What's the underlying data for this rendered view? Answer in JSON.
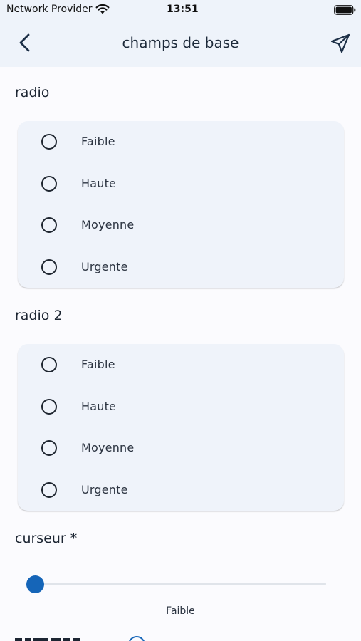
{
  "status_bar": {
    "carrier": "Network Provider",
    "time": "13:51"
  },
  "nav": {
    "title": "champs de base",
    "back_icon": "chevron-left-icon",
    "send_icon": "send-icon"
  },
  "radio_group_1": {
    "label": "radio",
    "options": [
      "Faible",
      "Haute",
      "Moyenne",
      "Urgente"
    ]
  },
  "radio_group_2": {
    "label": "radio 2",
    "options": [
      "Faible",
      "Haute",
      "Moyenne",
      "Urgente"
    ]
  },
  "slider": {
    "label": "curseur *",
    "value_label": "Faible",
    "position": 0,
    "accent_color": "#1565b8"
  }
}
